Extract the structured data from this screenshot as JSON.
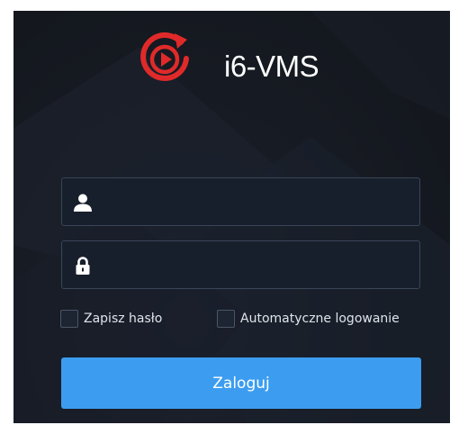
{
  "app": {
    "title": "i6-VMS",
    "logo_icon": "play-refresh-logo-icon",
    "logo_color": "#e02a2a"
  },
  "login": {
    "username_icon": "user-icon",
    "username_value": "",
    "password_icon": "lock-icon",
    "password_value": "",
    "remember_label": "Zapisz hasło",
    "remember_checked": false,
    "autologin_label": "Automatyczne logowanie",
    "autologin_checked": false,
    "submit_label": "Zaloguj"
  },
  "colors": {
    "background": "#161a22",
    "field_background": "#181f2c",
    "field_border": "#3a4558",
    "button": "#3c9df0",
    "text": "#ffffff"
  }
}
